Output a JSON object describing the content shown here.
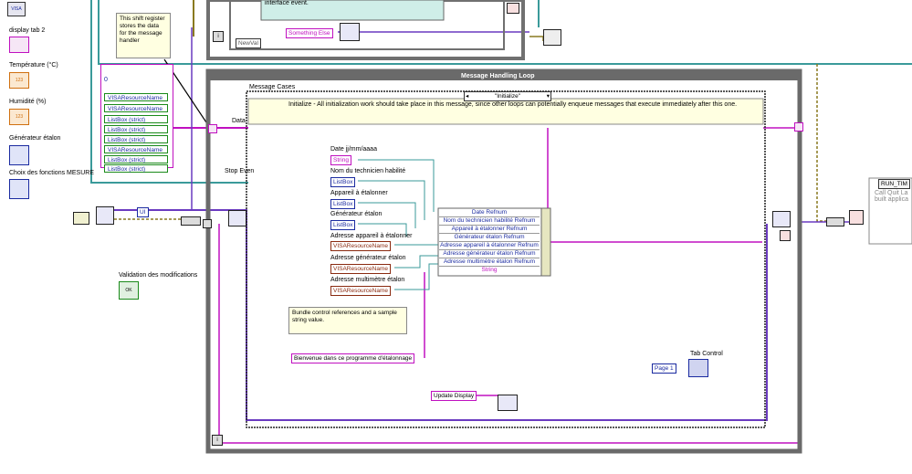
{
  "left_palette": {
    "visa_small": "VISA",
    "items": [
      {
        "label": "display tab 2"
      },
      {
        "label": "Température (°C)",
        "glyph": "123"
      },
      {
        "label": "Humidité (%)",
        "glyph": "123"
      },
      {
        "label": "Générateur étalon"
      },
      {
        "label": "Choix des fonctions MESURE"
      }
    ],
    "validation_label": "Validation des modifications",
    "validation_button": "OK"
  },
  "top_area": {
    "event_text": "interface event.",
    "newval_label": "NewVal",
    "something_else": "Something Else"
  },
  "shift_register": {
    "note": "This shift register stores the data for the message handler",
    "zero": "0",
    "items": [
      "VISAResourceName",
      "VISAResourceName",
      "ListBox (strict)",
      "ListBox (strict)",
      "ListBox (strict)",
      "VISAResourceName",
      "ListBox (strict)",
      "ListBox (strict)"
    ]
  },
  "loop": {
    "title": "Message Handling Loop",
    "cases_label": "Message Cases",
    "case_selector": "\"Initialize\"",
    "description": "Initialize - All initialization work should take place in this message, since other loops can potentially enqueue messages that execute immediately after this one.",
    "data_label": "Data",
    "stop_label": "Stop Even",
    "ui_label": "UI"
  },
  "controls": [
    {
      "title": "Date jj/mm/aaaa",
      "ref": "String",
      "kind": "pink"
    },
    {
      "title": "Nom du technicien habilité",
      "ref": "ListBox",
      "kind": "blue"
    },
    {
      "title": "Appareil à étalonner",
      "ref": "ListBox",
      "kind": "blue"
    },
    {
      "title": "Générateur étalon",
      "ref": "ListBox",
      "kind": "blue"
    },
    {
      "title": "Adresse appareil à étalonner",
      "ref": "VISAResourceName",
      "kind": "brown"
    },
    {
      "title": "Adresse générateur étalon",
      "ref": "VISAResourceName",
      "kind": "brown"
    },
    {
      "title": "Adresse multimètre étalon",
      "ref": "VISAResourceName",
      "kind": "brown"
    }
  ],
  "bundle": [
    "Date Refnum",
    "Nom du technicien habilité Refnum",
    "Appareil à étalonner Refnum",
    "Générateur étalon Refnum",
    "Adresse appareil à étalonner Refnum",
    "Adresse générateur étalon Refnum",
    "Adresse multimètre étalon Refnum",
    "String"
  ],
  "bundle_note": "Bundle control references and a sample string value.",
  "welcome_string": "Bienvenue dans ce programme d'étalonnage",
  "update_display": "Update Display",
  "tab_control": {
    "label": "Tab Control",
    "page": "Page 1"
  },
  "right": {
    "run_time_title": "RUN_TIM",
    "run_time_text": "Call Quit La built applica"
  },
  "colors": {
    "pink": "#c010c0",
    "blue": "#1a2aa0",
    "brown": "#8a2a10",
    "teal": "#3a9a9a",
    "olive": "#8a7a20"
  }
}
